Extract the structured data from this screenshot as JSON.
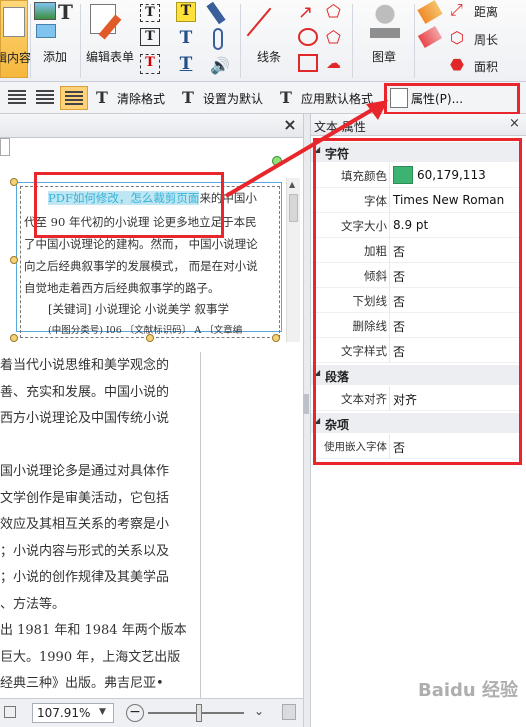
{
  "ribbon": {
    "edit_content_label": "辑内容",
    "add_label": "添加",
    "edit_form_label": "编辑表单",
    "lines_label": "线条",
    "stamp_label": "图章",
    "distance_label": "距离",
    "perimeter_label": "周长",
    "area_label": "面积"
  },
  "toolbar": {
    "clear_format_label": "清除格式",
    "set_default_label": "设置为默认",
    "apply_default_label": "应用默认格式",
    "properties_label": "属性(P)..."
  },
  "document": {
    "close_label": "×",
    "highlight_text": "PDF如何修改，怎么裁剪页面",
    "line1_tail": "来的中国小",
    "line2": "代至 90 年代初的小说理 论更多地立足于本民",
    "line3": "了中国小说理论的建构。然而， 中国小说理论",
    "line4": "向之后经典叙事学的发展模式， 而是在对小说",
    "line5": "自觉地走着西方后经典叙事学的路子。",
    "line6": "[关键词] 小说理论     小说美学     叙事学",
    "line7": "(中图分类号) I06  〔文献标识码〕 A  〔文章编",
    "body_lines": [
      "着当代小说思维和美学观念的",
      "善、充实和发展。中国小说的",
      "西方小说理论及中国传统小说",
      "",
      "国小说理论多是通过对具体作",
      "文学创作是审美活动，它包括",
      "效应及其相互关系的考察是小",
      "；小说内容与形式的关系以及",
      "；小说的创作规律及其美学品",
      "、方法等。",
      "出 1981 年和 1984 年两个版本",
      "巨大。1990 年，上海文艺出版",
      "经典三种》出版。弗吉尼亚•"
    ]
  },
  "status": {
    "zoom_value": "107.91%"
  },
  "props": {
    "title": "文本 属性",
    "close_label": "×",
    "groups": {
      "char": "字符",
      "para": "段落",
      "misc": "杂项"
    },
    "rows": {
      "fill_color_key": "填充颜色",
      "fill_color_value": "60,179,113",
      "font_key": "字体",
      "font_value": "Times New Roman",
      "size_key": "文字大小",
      "size_value": "8.9 pt",
      "bold_key": "加粗",
      "bold_value": "否",
      "italic_key": "倾斜",
      "italic_value": "否",
      "underline_key": "下划线",
      "underline_value": "否",
      "strike_key": "删除线",
      "strike_value": "否",
      "style_key": "文字样式",
      "style_value": "否",
      "align_key": "文本对齐",
      "align_value": "对齐",
      "embed_key": "使用嵌入字体",
      "embed_value": "否"
    }
  },
  "colors": {
    "fill_swatch": "#3cb371",
    "highlight": "#36b3d6",
    "annotation_red": "#e8262b"
  },
  "watermark": "Baidu 经验"
}
